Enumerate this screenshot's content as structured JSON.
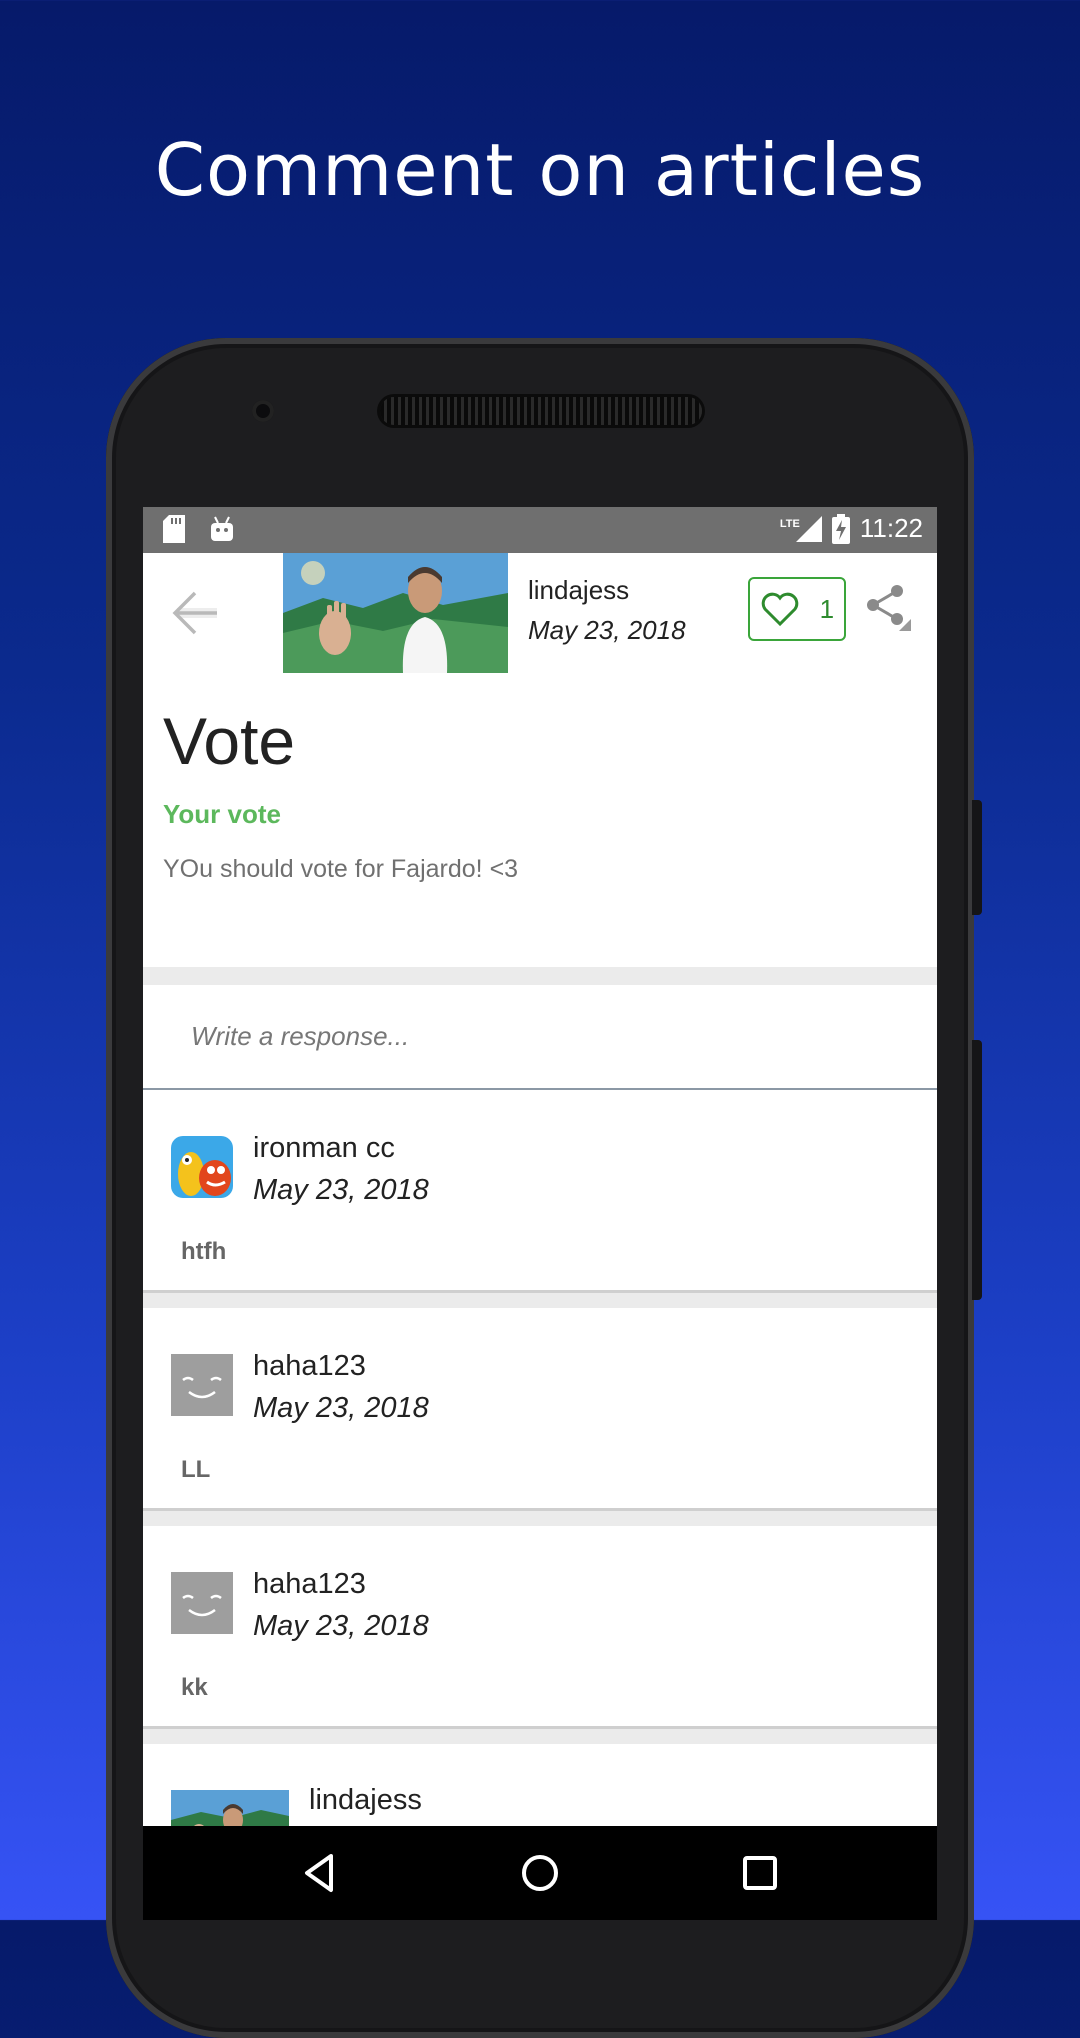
{
  "headline": "Comment on articles",
  "status_bar": {
    "time": "11:22",
    "network": "LTE"
  },
  "toolbar": {
    "author": "lindajess",
    "date": "May 23, 2018",
    "like_count": "1"
  },
  "article": {
    "title": "Vote",
    "subtitle": "Your vote",
    "body": "YOu should vote for Fajardo! <3"
  },
  "response": {
    "placeholder": "Write a response..."
  },
  "comments": [
    {
      "name": "ironman cc",
      "date": "May 23, 2018",
      "body": "htfh"
    },
    {
      "name": "haha123",
      "date": "May 23, 2018",
      "body": "LL"
    },
    {
      "name": "haha123",
      "date": "May 23, 2018",
      "body": "kk"
    },
    {
      "name": "lindajess"
    }
  ],
  "colors": {
    "accent_green": "#5cb85c",
    "like_green": "#3aa53a",
    "status_bar": "#6f6f6f",
    "background_top": "#061a6a",
    "background_bottom": "#3653f5"
  },
  "icons": [
    "back-arrow-icon",
    "heart-icon",
    "share-icon",
    "sd-card-icon",
    "android-icon",
    "signal-icon",
    "battery-charging-icon",
    "nav-back-icon",
    "nav-home-icon",
    "nav-recents-icon",
    "default-avatar-icon"
  ]
}
